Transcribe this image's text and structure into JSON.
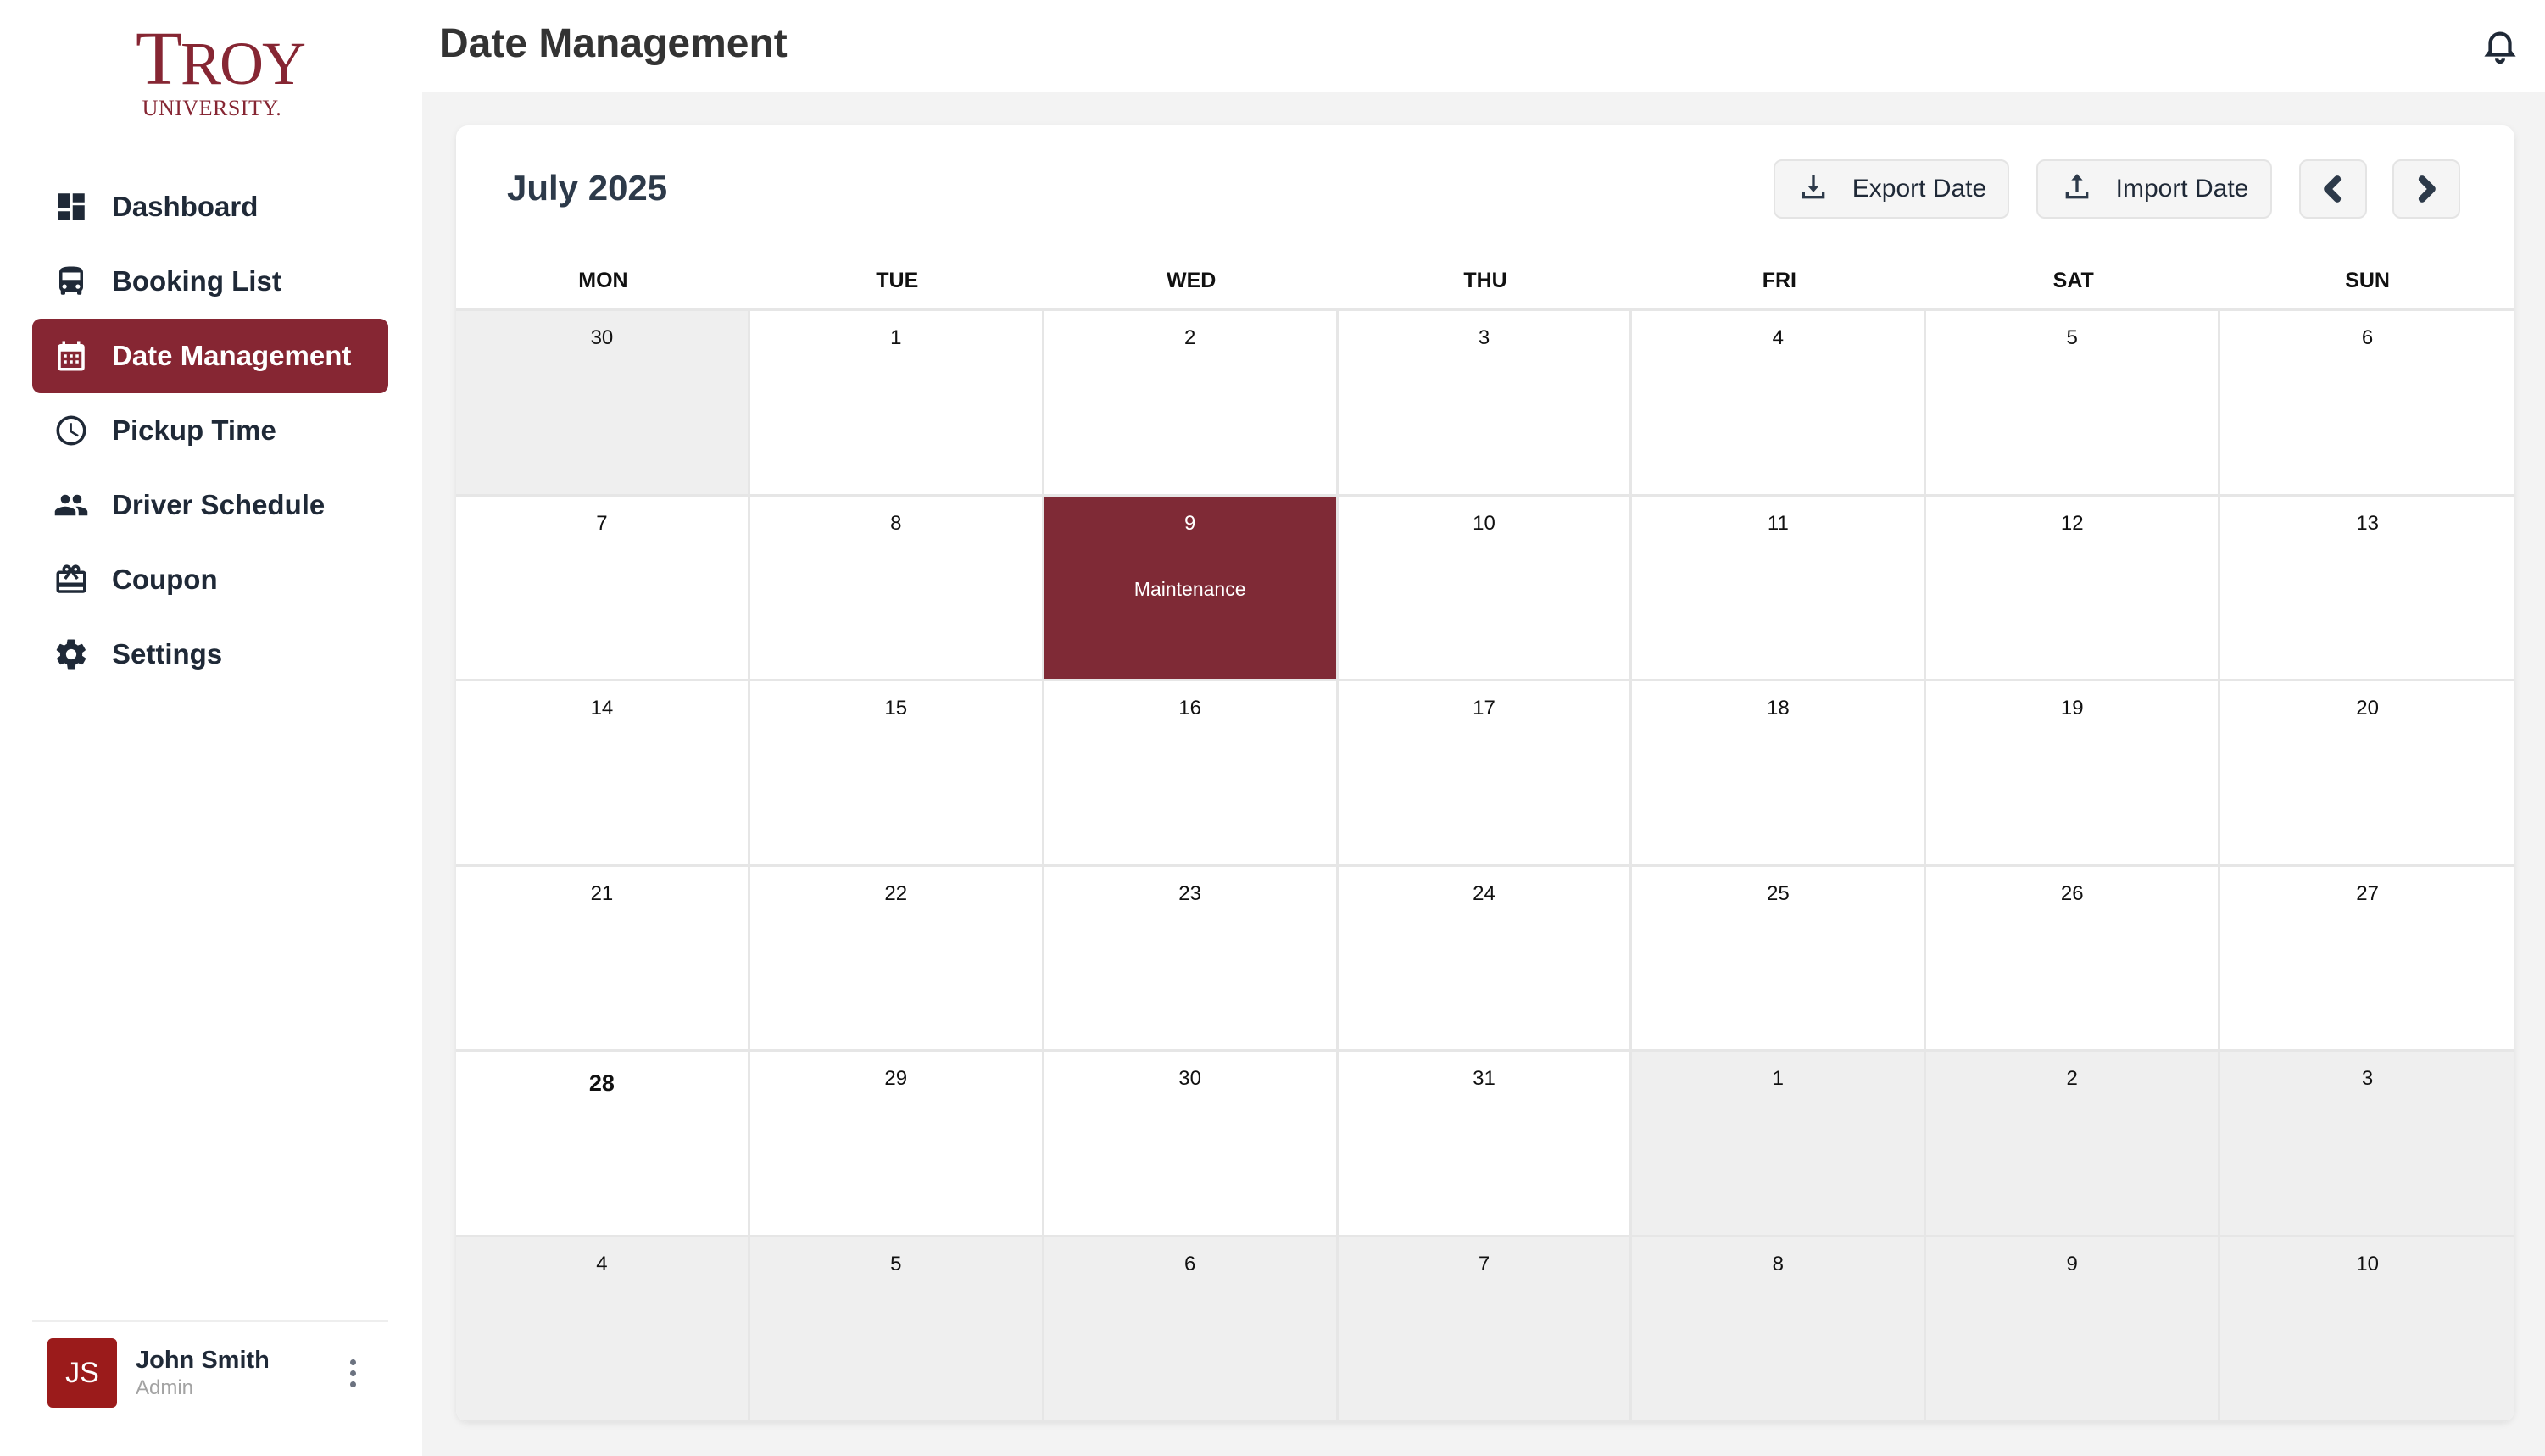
{
  "brand": {
    "name_first": "T",
    "name_rest": "ROY",
    "sub": "UNIVERSITY."
  },
  "header": {
    "title": "Date Management"
  },
  "sidebar": {
    "items": [
      {
        "label": "Dashboard",
        "icon": "dashboard-icon",
        "active": false
      },
      {
        "label": "Booking List",
        "icon": "bus-icon",
        "active": false
      },
      {
        "label": "Date Management",
        "icon": "calendar-icon",
        "active": true
      },
      {
        "label": "Pickup Time",
        "icon": "clock-icon",
        "active": false
      },
      {
        "label": "Driver Schedule",
        "icon": "people-icon",
        "active": false
      },
      {
        "label": "Coupon",
        "icon": "gift-card-icon",
        "active": false
      },
      {
        "label": "Settings",
        "icon": "gear-icon",
        "active": false
      }
    ]
  },
  "user": {
    "initials": "JS",
    "name": "John Smith",
    "role": "Admin"
  },
  "calendar": {
    "month_label": "July 2025",
    "export_label": "Export Date",
    "import_label": "Import Date",
    "weekdays": [
      "MON",
      "TUE",
      "WED",
      "THU",
      "FRI",
      "SAT",
      "SUN"
    ],
    "days": [
      {
        "n": "30",
        "muted": true
      },
      {
        "n": "1"
      },
      {
        "n": "2"
      },
      {
        "n": "3"
      },
      {
        "n": "4"
      },
      {
        "n": "5"
      },
      {
        "n": "6"
      },
      {
        "n": "7"
      },
      {
        "n": "8"
      },
      {
        "n": "9",
        "event": "Maintenance"
      },
      {
        "n": "10"
      },
      {
        "n": "11"
      },
      {
        "n": "12"
      },
      {
        "n": "13"
      },
      {
        "n": "14"
      },
      {
        "n": "15"
      },
      {
        "n": "16"
      },
      {
        "n": "17"
      },
      {
        "n": "18"
      },
      {
        "n": "19"
      },
      {
        "n": "20"
      },
      {
        "n": "21"
      },
      {
        "n": "22"
      },
      {
        "n": "23"
      },
      {
        "n": "24"
      },
      {
        "n": "25"
      },
      {
        "n": "26"
      },
      {
        "n": "27"
      },
      {
        "n": "28",
        "today": true
      },
      {
        "n": "29"
      },
      {
        "n": "30"
      },
      {
        "n": "31"
      },
      {
        "n": "1",
        "muted": true
      },
      {
        "n": "2",
        "muted": true
      },
      {
        "n": "3",
        "muted": true
      },
      {
        "n": "4",
        "muted": true
      },
      {
        "n": "5",
        "muted": true
      },
      {
        "n": "6",
        "muted": true
      },
      {
        "n": "7",
        "muted": true
      },
      {
        "n": "8",
        "muted": true
      },
      {
        "n": "9",
        "muted": true
      },
      {
        "n": "10",
        "muted": true
      }
    ]
  },
  "colors": {
    "brand": "#862633",
    "event": "#7f2a36",
    "avatar": "#9b1b1b"
  }
}
